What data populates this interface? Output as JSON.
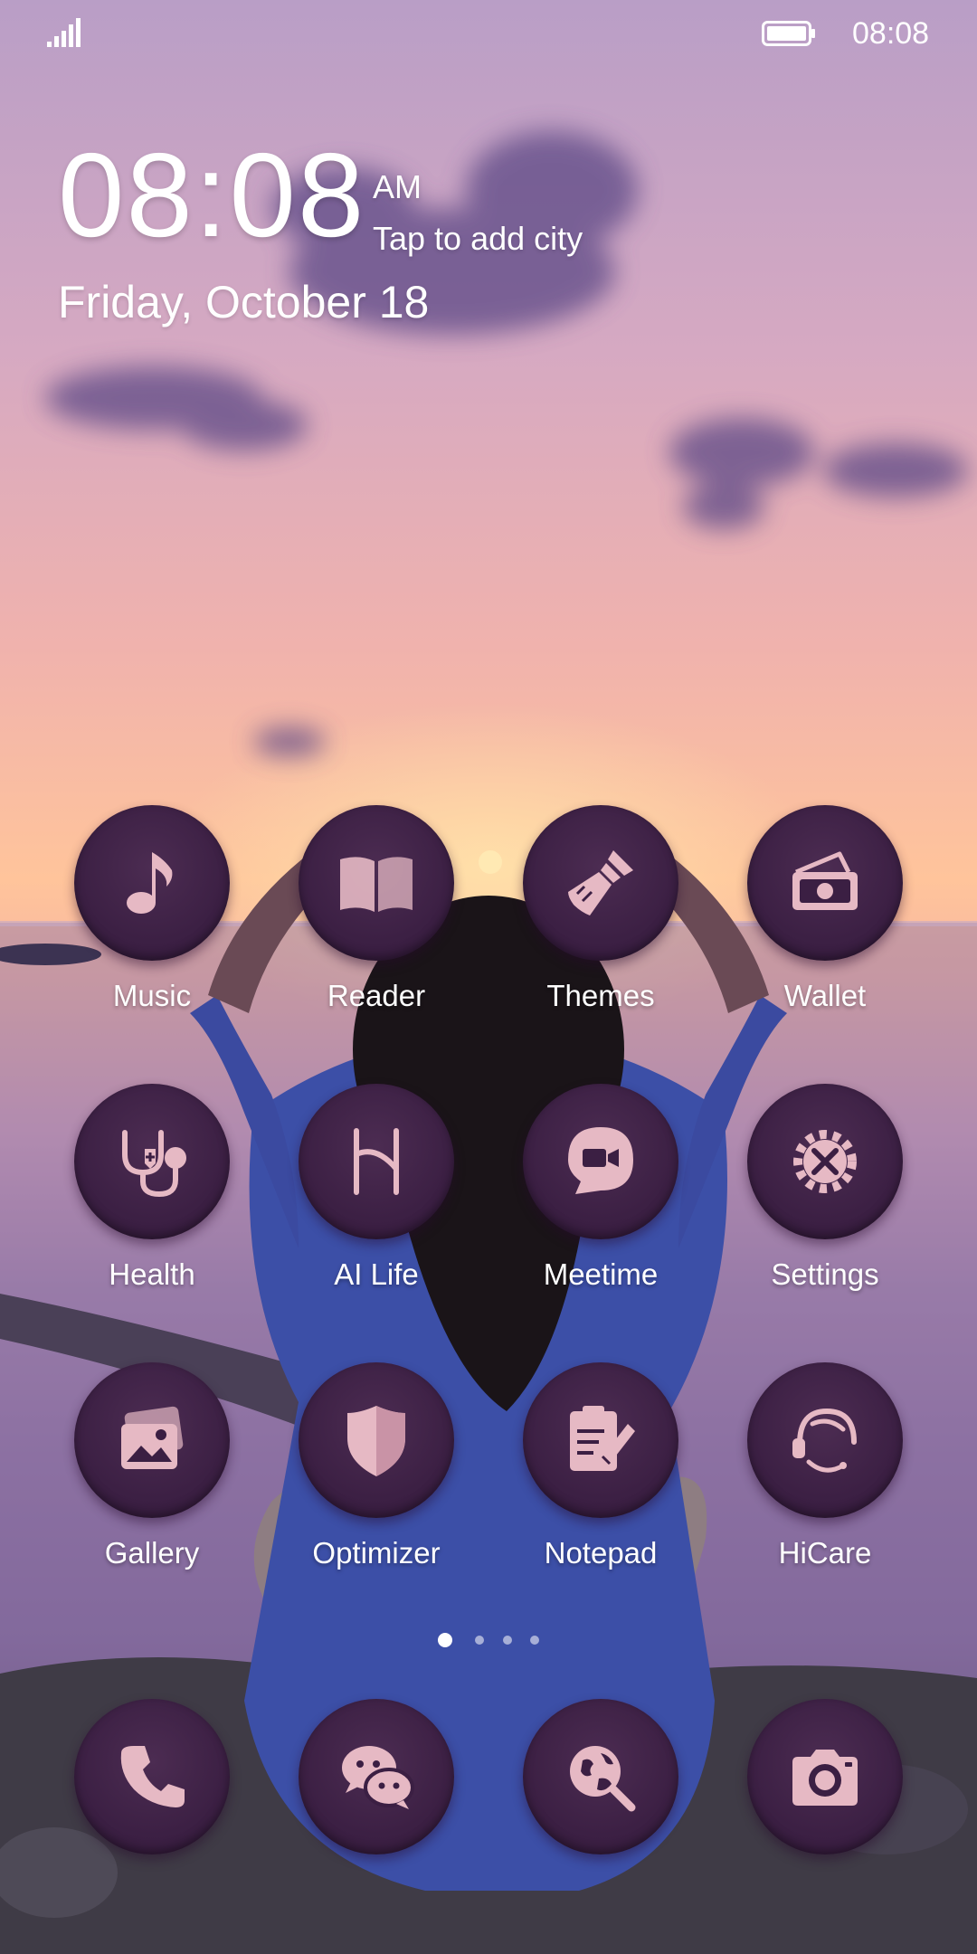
{
  "status_bar": {
    "time": "08:08",
    "battery_icon": "battery-icon",
    "signal_icon": "signal-icon"
  },
  "clock": {
    "time": "08:08",
    "ampm": "AM",
    "city": "Tap to add city",
    "date": "Friday, October 18"
  },
  "apps": [
    {
      "label": "Music",
      "icon": "music-note-icon"
    },
    {
      "label": "Reader",
      "icon": "book-icon"
    },
    {
      "label": "Themes",
      "icon": "paintbrush-icon"
    },
    {
      "label": "Wallet",
      "icon": "wallet-icon"
    },
    {
      "label": "Health",
      "icon": "stethoscope-icon"
    },
    {
      "label": "AI Life",
      "icon": "ai-life-icon"
    },
    {
      "label": "Meetime",
      "icon": "video-call-icon"
    },
    {
      "label": "Settings",
      "icon": "gear-icon"
    },
    {
      "label": "Gallery",
      "icon": "gallery-icon"
    },
    {
      "label": "Optimizer",
      "icon": "shield-icon"
    },
    {
      "label": "Notepad",
      "icon": "notepad-icon"
    },
    {
      "label": "HiCare",
      "icon": "headset-icon"
    }
  ],
  "pagination": {
    "count": 4,
    "active": 1
  },
  "dock": [
    {
      "icon": "phone-icon"
    },
    {
      "icon": "chat-icon"
    },
    {
      "icon": "browser-icon"
    },
    {
      "icon": "camera-icon"
    }
  ],
  "colors": {
    "icon_bg": "#3b1f43",
    "icon_fg": "#e6b9c4",
    "sky_top": "#b99ec6",
    "sky_glow": "#ffc49b"
  }
}
